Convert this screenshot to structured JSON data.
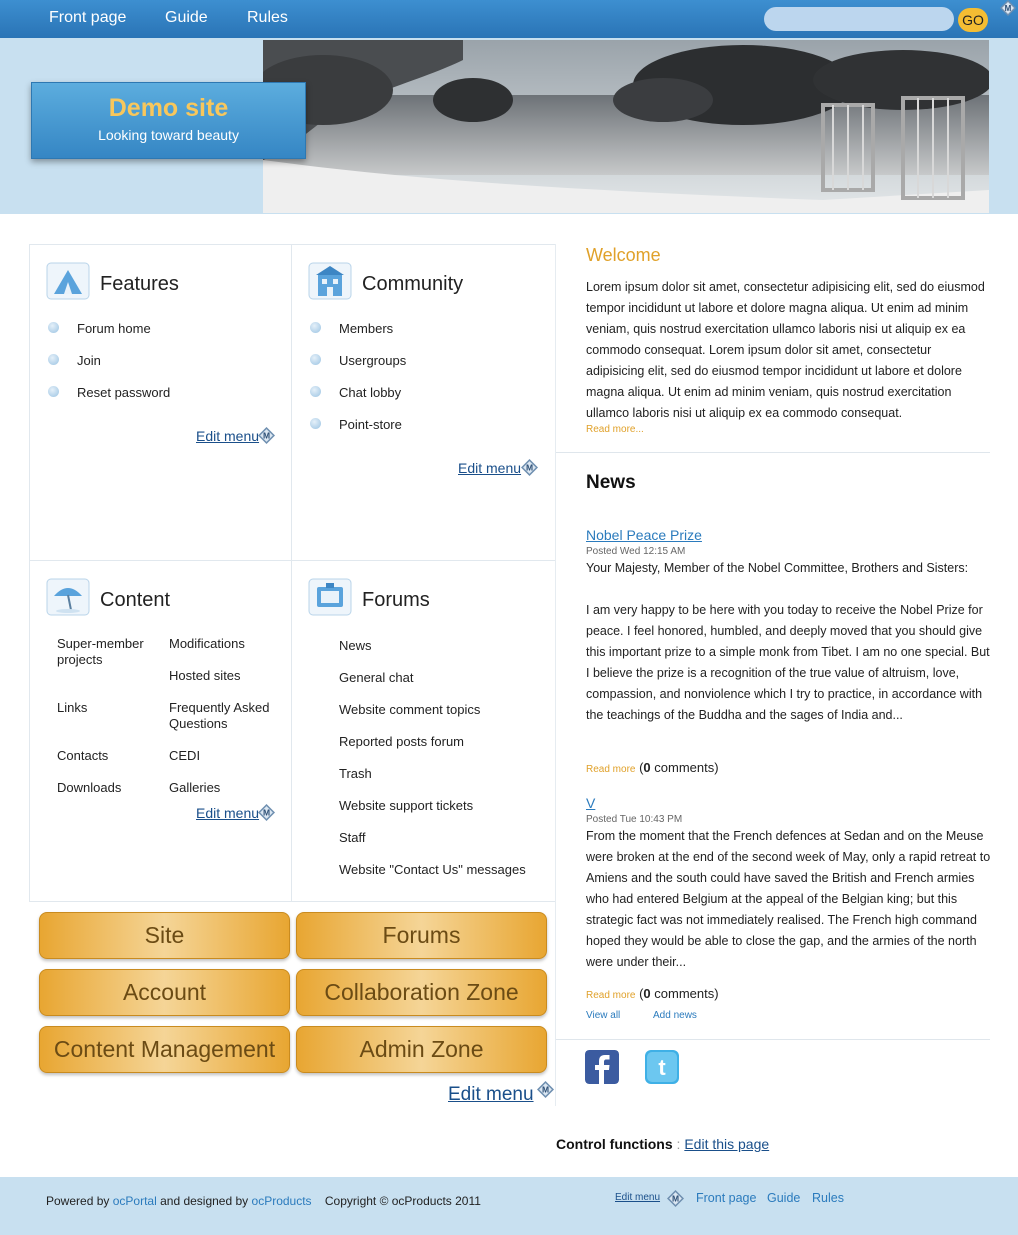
{
  "nav": {
    "links": [
      "Front page",
      "Guide",
      "Rules"
    ],
    "search_placeholder": "",
    "go_label": "GO"
  },
  "site": {
    "title": "Demo site",
    "tagline": "Looking toward beauty"
  },
  "panels": {
    "features": {
      "title": "Features",
      "items": [
        "Forum home",
        "Join",
        "Reset password"
      ],
      "edit": "Edit menu"
    },
    "community": {
      "title": "Community",
      "items": [
        "Members",
        "Usergroups",
        "Chat lobby",
        "Point-store"
      ],
      "edit": "Edit menu"
    },
    "content": {
      "title": "Content",
      "items": [
        "Super-member projects",
        "Modifications",
        "Hosted sites",
        "Links",
        "Frequently Asked Questions",
        "Contacts",
        "CEDI",
        "Downloads",
        "Galleries"
      ],
      "edit": "Edit menu"
    },
    "forums": {
      "title": "Forums",
      "items": [
        "News",
        "General chat",
        "Website comment topics",
        "Reported posts forum",
        "Trash",
        "Website support tickets",
        "Staff",
        "Website \"Contact Us\" messages"
      ]
    }
  },
  "zones": [
    "Site",
    "Forums",
    "Account",
    "Collaboration Zone",
    "Content Management",
    "Admin Zone"
  ],
  "zones_edit": "Edit menu",
  "welcome": {
    "title": "Welcome",
    "body": "Lorem ipsum dolor sit amet, consectetur adipisicing elit, sed do eiusmod tempor incididunt ut labore et dolore magna aliqua. Ut enim ad minim veniam, quis nostrud exercitation ullamco laboris nisi ut aliquip ex ea commodo consequat. Lorem ipsum dolor sit amet, consectetur adipisicing elit, sed do eiusmod tempor incididunt ut labore et dolore magna aliqua. Ut enim ad minim veniam, quis nostrud exercitation ullamco laboris nisi ut aliquip ex ea commodo consequat.",
    "read_more": "Read more..."
  },
  "news": {
    "heading": "News",
    "items": [
      {
        "title": "Nobel Peace Prize",
        "date": "Posted Wed 12:15 AM",
        "body1": "Your Majesty, Member of the Nobel Committee, Brothers and Sisters:",
        "body2": "I am very happy to be here with you today to receive the Nobel Prize for peace. I feel honored, humbled, and deeply moved that you should give this important prize to a simple monk from Tibet. I am no one special. But I believe the prize is a recognition of the true value of altruism, love, compassion, and nonviolence which I try to practice, in accordance with the teachings of the Buddha and the sages of India and...",
        "read_more": "Read more",
        "comments": "0",
        "comments_label": "comments)"
      },
      {
        "title": "V",
        "date": "Posted Tue 10:43 PM",
        "body1": "From the moment that the French defences at Sedan and on the Meuse were broken at the end of the second week of May, only a rapid retreat to Amiens and the south could have saved the British and French armies who had entered Belgium at the appeal of the Belgian king; but this strategic fact was not immediately realised. The French high command hoped they would be able to close the gap, and the armies of the north were under their...",
        "read_more": "Read more",
        "comments": "0",
        "comments_label": "comments)"
      }
    ],
    "view_all": "View all",
    "add_news": "Add news"
  },
  "social": [
    "facebook-icon",
    "twitter-icon"
  ],
  "control": {
    "label": "Control functions",
    "sep": ":",
    "link": "Edit this page"
  },
  "footer": {
    "powered": "Powered by",
    "ocportal": "ocPortal",
    "designed": "and designed by",
    "ocproducts": "ocProducts",
    "copyright": "Copyright © ocProducts 2011",
    "edit": "Edit menu",
    "links": [
      "Front page",
      "Guide",
      "Rules"
    ]
  },
  "colors": {
    "nav": "#2a74b6",
    "header": "#c8e0f0",
    "accent": "#e0a12a",
    "link": "#2b7bbd"
  }
}
